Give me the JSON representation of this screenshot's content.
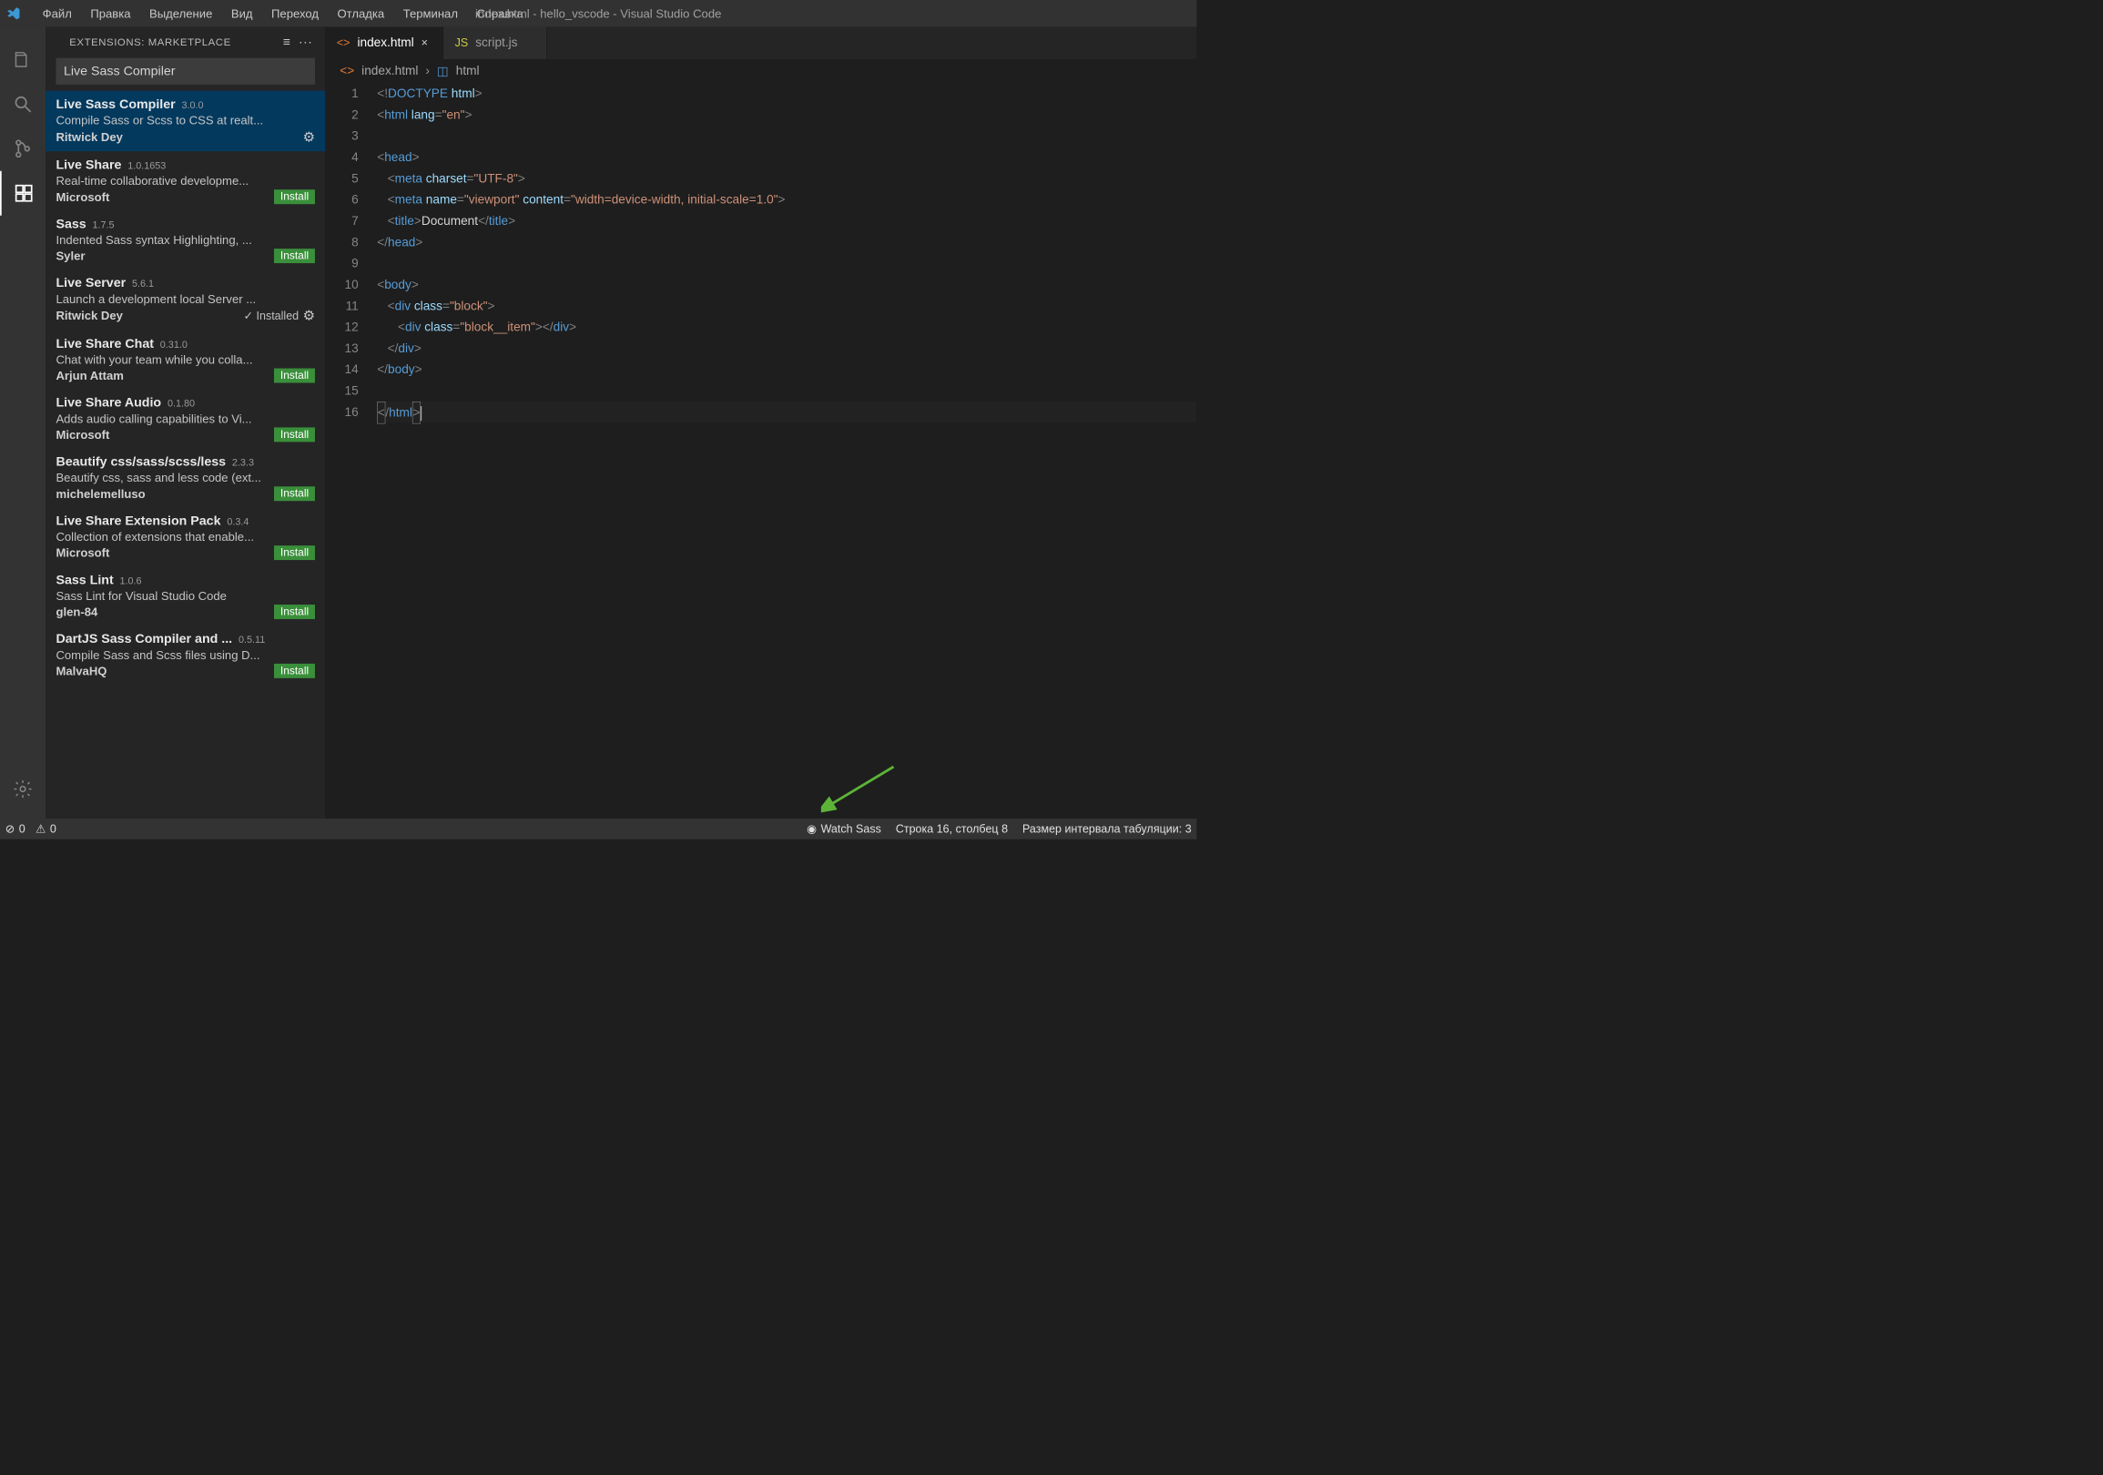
{
  "menu": {
    "items": [
      "Файл",
      "Правка",
      "Выделение",
      "Вид",
      "Переход",
      "Отладка",
      "Терминал",
      "Справка"
    ],
    "title": "index.html - hello_vscode - Visual Studio Code"
  },
  "sidebar": {
    "header": "EXTENSIONS: MARKETPLACE",
    "search_value": "Live Sass Compiler",
    "items": [
      {
        "name": "Live Sass Compiler",
        "version": "3.0.0",
        "desc": "Compile Sass or Scss to CSS at realt...",
        "author": "Ritwick Dey",
        "state": "gear"
      },
      {
        "name": "Live Share",
        "version": "1.0.1653",
        "desc": "Real-time collaborative developme...",
        "author": "Microsoft",
        "state": "install"
      },
      {
        "name": "Sass",
        "version": "1.7.5",
        "desc": "Indented Sass syntax Highlighting, ...",
        "author": "Syler",
        "state": "install"
      },
      {
        "name": "Live Server",
        "version": "5.6.1",
        "desc": "Launch a development local Server ...",
        "author": "Ritwick Dey",
        "state": "installed"
      },
      {
        "name": "Live Share Chat",
        "version": "0.31.0",
        "desc": "Chat with your team while you colla...",
        "author": "Arjun Attam",
        "state": "install"
      },
      {
        "name": "Live Share Audio",
        "version": "0.1.80",
        "desc": "Adds audio calling capabilities to Vi...",
        "author": "Microsoft",
        "state": "install"
      },
      {
        "name": "Beautify css/sass/scss/less",
        "version": "2.3.3",
        "desc": "Beautify css, sass and less code (ext...",
        "author": "michelemelluso",
        "state": "install"
      },
      {
        "name": "Live Share Extension Pack",
        "version": "0.3.4",
        "desc": "Collection of extensions that enable...",
        "author": "Microsoft",
        "state": "install"
      },
      {
        "name": "Sass Lint",
        "version": "1.0.6",
        "desc": "Sass Lint for Visual Studio Code",
        "author": "glen-84",
        "state": "install"
      },
      {
        "name": "DartJS Sass Compiler and ...",
        "version": "0.5.11",
        "desc": "Compile Sass and Scss files using D...",
        "author": "MalvaHQ",
        "state": "install"
      }
    ],
    "install_label": "Install",
    "installed_label": "Installed"
  },
  "tabs": {
    "items": [
      {
        "label": "index.html",
        "icon": "<>",
        "active": true
      },
      {
        "label": "script.js",
        "icon": "JS",
        "active": false
      }
    ]
  },
  "breadcrumb": {
    "file": "index.html",
    "node": "html"
  },
  "code": {
    "lines_total": 16
  },
  "statusbar": {
    "errors": "0",
    "warnings": "0",
    "watch_sass": "Watch Sass",
    "line_col": "Строка 16, столбец 8",
    "tab_size": "Размер интервала табуляции: 3"
  }
}
